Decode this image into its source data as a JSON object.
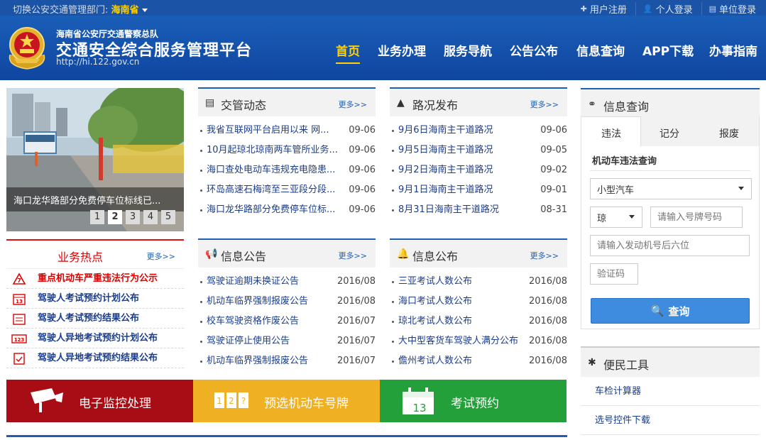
{
  "topbar": {
    "dept_label": "切换公安交通管理部门:",
    "dept_value": "海南省",
    "links": [
      {
        "label": "用户注册",
        "icon": "plus-icon"
      },
      {
        "label": "个人登录",
        "icon": "user-icon"
      },
      {
        "label": "单位登录",
        "icon": "document-icon"
      }
    ]
  },
  "header": {
    "org": "海南省公安厅交通警察总队",
    "site_name": "交通安全综合服务管理平台",
    "url": "http://hi.122.gov.cn"
  },
  "nav": [
    "首页",
    "业务办理",
    "服务导航",
    "公告公布",
    "信息查询",
    "APP下载",
    "办事指南"
  ],
  "slider": {
    "caption": "海口龙华路部分免费停车位标线已...",
    "pages": [
      "1",
      "2",
      "3",
      "4",
      "5"
    ],
    "current": "2"
  },
  "news": {
    "title": "交管动态",
    "more": "更多>>",
    "items": [
      {
        "t": "我省互联网平台启用以来 网...",
        "d": "09-06"
      },
      {
        "t": "10月起琼北琼南两车管所业务...",
        "d": "09-06"
      },
      {
        "t": "海口查处电动车违规充电隐患...",
        "d": "09-06"
      },
      {
        "t": "环岛高速石梅湾至三亚段分段...",
        "d": "09-06"
      },
      {
        "t": "海口龙华路部分免费停车位标...",
        "d": "09-06"
      }
    ]
  },
  "road": {
    "title": "路况发布",
    "more": "更多>>",
    "items": [
      {
        "t": "9月6日海南主干道路况",
        "d": "09-06"
      },
      {
        "t": "9月5日海南主干道路况",
        "d": "09-05"
      },
      {
        "t": "9月2日海南主干道路况",
        "d": "09-02"
      },
      {
        "t": "9月1日海南主干道路况",
        "d": "09-01"
      },
      {
        "t": "8月31日海南主干道路况",
        "d": "08-31"
      }
    ]
  },
  "hot": {
    "title": "业务热点",
    "more": "更多>>",
    "items": [
      "重点机动车严重违法行为公示",
      "驾驶人考试预约计划公布",
      "驾驶人考试预约结果公布",
      "驾驶人异地考试预约计划公布",
      "驾驶人异地考试预约结果公布"
    ]
  },
  "notice": {
    "title": "信息公告",
    "more": "更多>>",
    "items": [
      {
        "t": "驾驶证逾期未换证公告",
        "d": "2016/08"
      },
      {
        "t": "机动车临界强制报废公告",
        "d": "2016/08"
      },
      {
        "t": "校车驾驶资格作废公告",
        "d": "2016/07"
      },
      {
        "t": "驾驶证停止使用公告",
        "d": "2016/07"
      },
      {
        "t": "机动车临界强制报废公告",
        "d": "2016/07"
      }
    ]
  },
  "publish": {
    "title": "信息公布",
    "more": "更多>>",
    "items": [
      {
        "t": "三亚考试人数公布",
        "d": "2016/08"
      },
      {
        "t": "海口考试人数公布",
        "d": "2016/08"
      },
      {
        "t": "琼北考试人数公布",
        "d": "2016/08"
      },
      {
        "t": "大中型客货车驾驶人满分公布",
        "d": "2016/08"
      },
      {
        "t": "儋州考试人数公布",
        "d": "2016/08"
      }
    ]
  },
  "bars": [
    {
      "label": "电子监控处理",
      "color": "#a80c14"
    },
    {
      "label": "预选机动车号牌",
      "color": "#f0b024"
    },
    {
      "label": "考试预约",
      "color": "#23a03a"
    }
  ],
  "query": {
    "title": "信息查询",
    "tabs": [
      "违法",
      "记分",
      "报废"
    ],
    "heading": "机动车违法查询",
    "vehicle_type": "小型汽车",
    "province": "琼",
    "plate_placeholder": "请输入号牌号码",
    "engine_placeholder": "请输入发动机号后六位",
    "captcha_placeholder": "验证码",
    "button": "查询"
  },
  "tools": {
    "title": "便民工具",
    "items": [
      "车检计算器",
      "选号控件下载"
    ]
  }
}
